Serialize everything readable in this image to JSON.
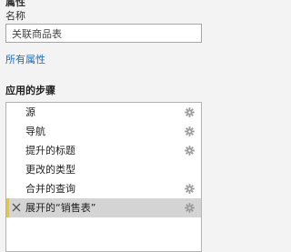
{
  "properties": {
    "section_title": "属性",
    "name_label": "名称",
    "name_value": "关联商品表",
    "all_properties_link": "所有属性"
  },
  "applied_steps": {
    "title": "应用的步骤",
    "items": [
      {
        "label": "源",
        "has_settings": true,
        "selected": false
      },
      {
        "label": "导航",
        "has_settings": true,
        "selected": false
      },
      {
        "label": "提升的标题",
        "has_settings": true,
        "selected": false
      },
      {
        "label": "更改的类型",
        "has_settings": false,
        "selected": false
      },
      {
        "label": "合并的查询",
        "has_settings": true,
        "selected": false
      },
      {
        "label": "展开的“销售表”",
        "has_settings": true,
        "selected": true
      }
    ]
  },
  "icons": {
    "settings": "gear-icon",
    "delete": "close-icon"
  },
  "colors": {
    "link": "#1e6bb8",
    "selected_row": "#d4d4d4",
    "selected_marker": "#f2c811"
  }
}
